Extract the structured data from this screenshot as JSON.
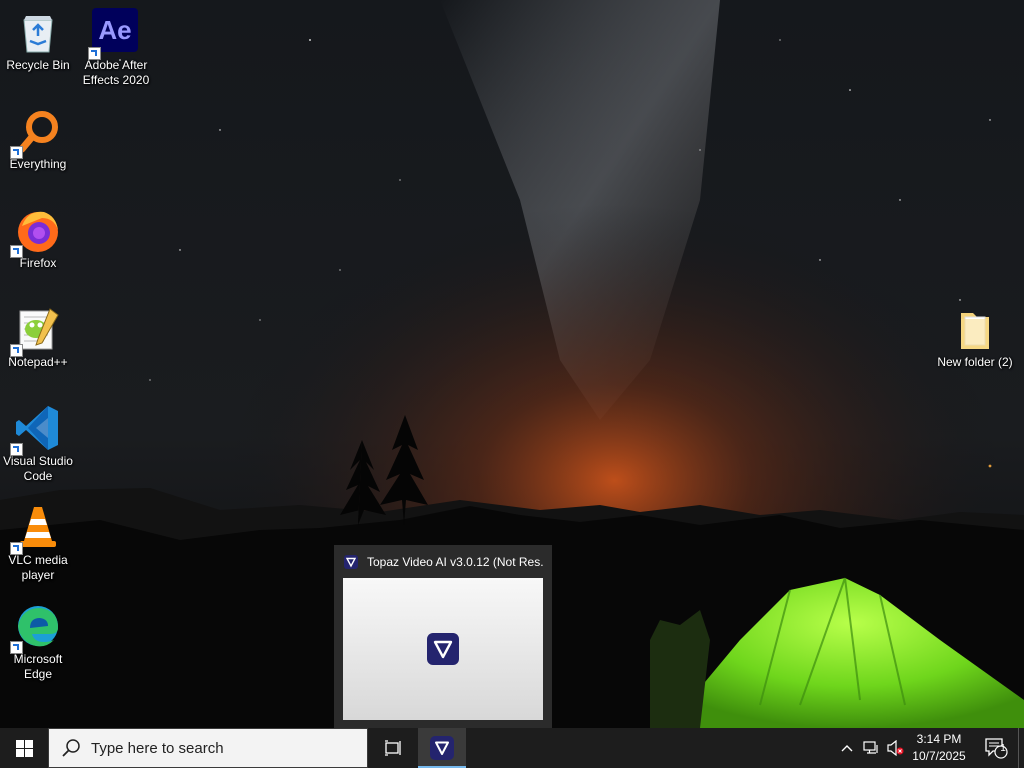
{
  "desktop": {
    "icons": [
      {
        "id": "recycle-bin",
        "label": "Recycle Bin"
      },
      {
        "id": "after-effects",
        "label": "Adobe After Effects 2020",
        "glyph": "Ae"
      },
      {
        "id": "everything",
        "label": "Everything"
      },
      {
        "id": "firefox",
        "label": "Firefox"
      },
      {
        "id": "notepadpp",
        "label": "Notepad++"
      },
      {
        "id": "vscode",
        "label": "Visual Studio Code"
      },
      {
        "id": "vlc",
        "label": "VLC media player"
      },
      {
        "id": "edge",
        "label": "Microsoft Edge"
      },
      {
        "id": "new-folder",
        "label": "New folder (2)"
      }
    ]
  },
  "thumbnail": {
    "title": "Topaz Video AI  v3.0.12 (Not Res..."
  },
  "taskbar": {
    "search_placeholder": "Type here to search",
    "clock": {
      "time": "3:14 PM",
      "date": "10/7/2025"
    },
    "notification_count": "1"
  },
  "colors": {
    "taskbar_bg": "#1d1d1d",
    "accent": "#76b9ed",
    "ae_brand": "#9999ff",
    "topaz_brand": "#2a2a8c"
  }
}
